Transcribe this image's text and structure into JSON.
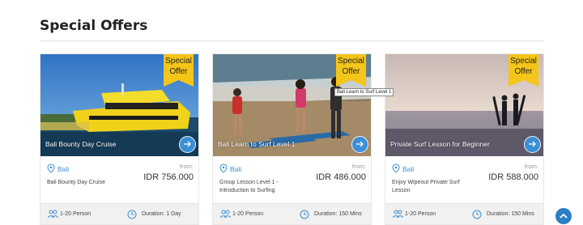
{
  "section": {
    "title": "Special Offers"
  },
  "ribbon": {
    "line1": "Special",
    "line2": "Offer",
    "color": "#f5c518"
  },
  "accent_color": "#3b8fd6",
  "tooltip": "Bali Learn to Surf Level 1",
  "offers": [
    {
      "image_title": "Bali Bounty Day Cruise",
      "location": "Bali",
      "description": "Bali Bounty Day Cruise",
      "from_label": "from:",
      "price": "IDR 756.000",
      "persons": "1-20 Person",
      "duration": "Duration: 1 Day"
    },
    {
      "image_title": "Bali Learn to Surf Level 1",
      "location": "Bali",
      "description": "Group Lesson Level 1 - Introduction to Surfing",
      "from_label": "from:",
      "price": "IDR 486.000",
      "persons": "1-20 Person",
      "duration": "Duration: 150 Mins"
    },
    {
      "image_title": "Private Surf Lesson for Beginner",
      "location": "Bali",
      "description": "Enjoy Wipeout Private Surf Lesson",
      "from_label": "from:",
      "price": "IDR 588.000",
      "persons": "1-20 Person",
      "duration": "Duration: 150 Mins"
    }
  ],
  "icons": {
    "location": "map-pin-icon",
    "persons": "group-icon",
    "duration": "clock-icon",
    "go": "arrow-right-icon",
    "scroll_top": "chevron-up-icon"
  }
}
